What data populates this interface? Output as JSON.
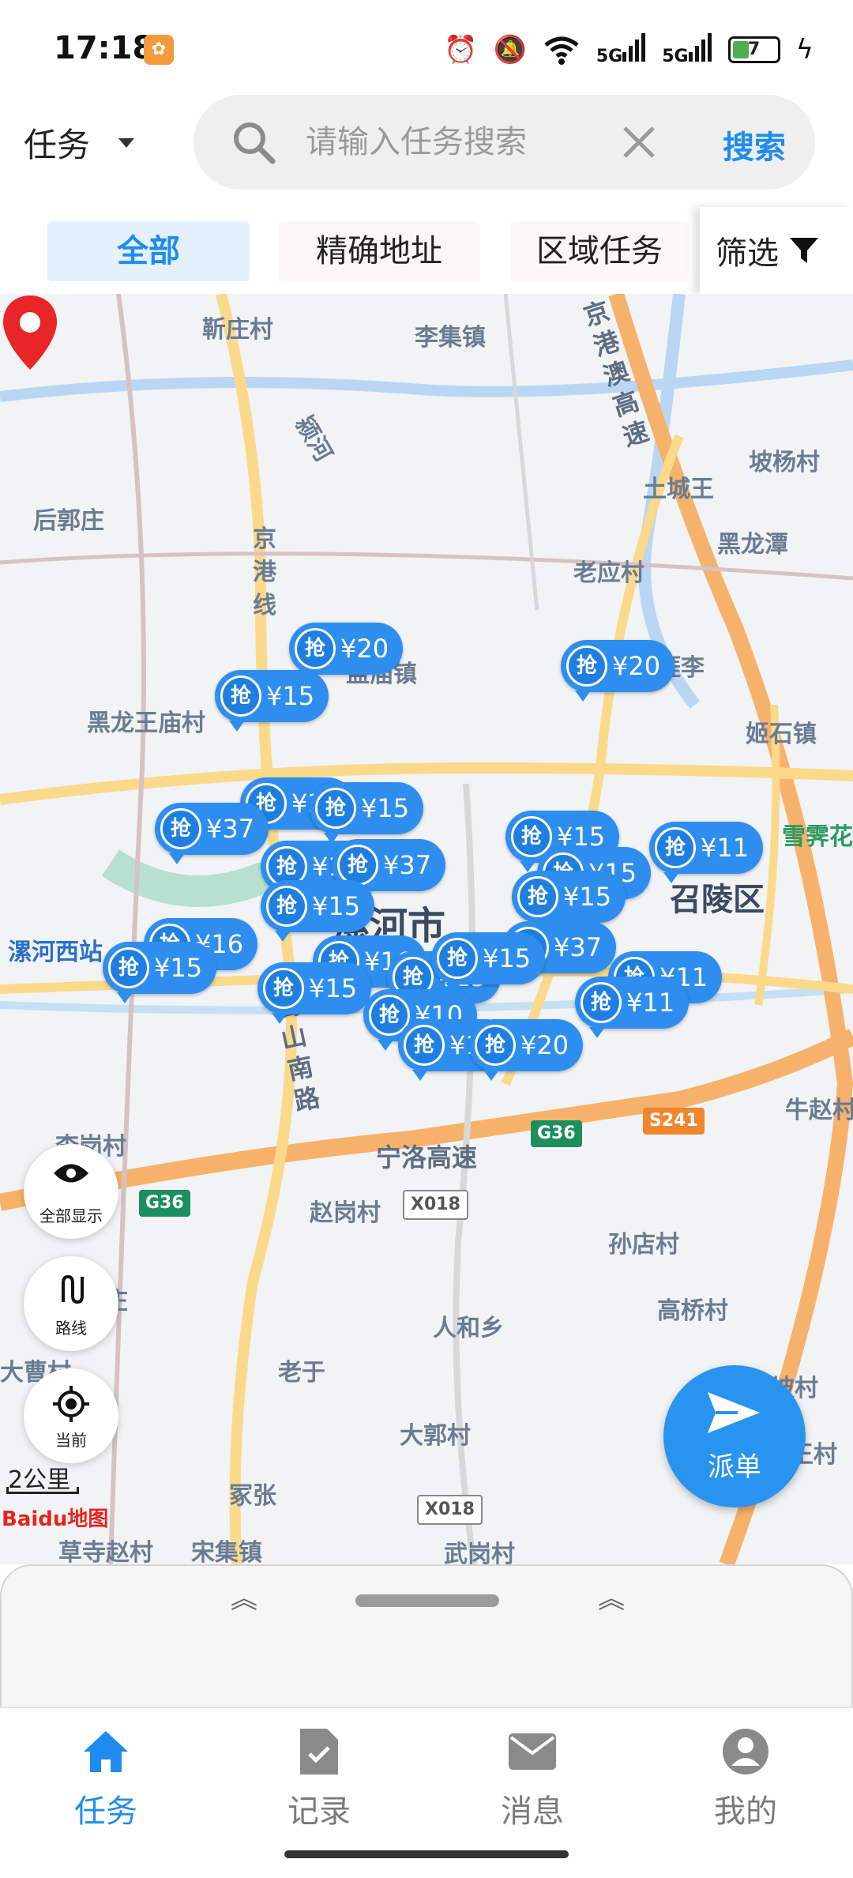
{
  "status_bar": {
    "time": "17:18",
    "signal_1": "5G",
    "signal_2": "5G",
    "battery": "7"
  },
  "header": {
    "dropdown_label": "任务",
    "search_placeholder": "请输入任务搜索",
    "search_button": "搜索"
  },
  "tabs": [
    {
      "label": "全部",
      "active": true
    },
    {
      "label": "精确地址",
      "active": false
    },
    {
      "label": "区域任务",
      "active": false
    }
  ],
  "filter_label": "筛选",
  "map": {
    "places": {
      "xinzhuang": "靳庄村",
      "lijizhen": "李集镇",
      "yinghe": "颍河",
      "poyang": "坡杨村",
      "tuchengwang": "土城王",
      "houguozhuang": "后郭庄",
      "heilongtan": "黑龙潭",
      "jinggangxian": "京港线",
      "laoying": "老应村",
      "mengmiao": "孟庙镇",
      "yali": "涯李",
      "heilongwangmiao": "黑龙王庙村",
      "jishi": "姬石镇",
      "xuezhai": "雪霁花",
      "zhaoling": "召陵区",
      "luohe": "漯河市",
      "luohexi": "漯河西站",
      "niuzhao": "牛赵村",
      "ligang": "李岗村",
      "songshan": "嵩山南路",
      "ningluo": "宁洛高速",
      "zhaogang": "赵岗村",
      "sundian": "孙店村",
      "gaoqiao": "高桥村",
      "renhe": "人和乡",
      "laoyu": "老于",
      "dacao": "大曹村",
      "xiapo": "下坡村",
      "daguo": "大郭村",
      "jiazhang": "冢张",
      "wanghe": "王村",
      "caosizhao": "草寺赵村",
      "songji": "宋集镇",
      "wugang": "武岗村",
      "zhuang": "庄",
      "jinggangao": "京港澳高速"
    },
    "shields": {
      "g36a": "G36",
      "g36b": "G36",
      "s241": "S241",
      "x018a": "X018",
      "x018b": "X018"
    },
    "pin_badge": "抢",
    "pins": [
      "¥20",
      "¥15",
      "¥20",
      "¥37",
      "¥15",
      "¥37",
      "¥15",
      "¥37",
      "¥15",
      "¥15",
      "¥15",
      "¥15",
      "¥11",
      "¥16",
      "¥15",
      "¥16",
      "¥15",
      "¥15",
      "¥37",
      "¥15",
      "¥11",
      "¥11",
      "¥10",
      "¥10",
      "¥20"
    ],
    "controls": {
      "show_all": "全部显示",
      "route": "路线",
      "current": "当前"
    },
    "scale": "2公里",
    "logo": "Baidu地图",
    "dispatch": "派单"
  },
  "nav": [
    {
      "label": "任务",
      "active": true
    },
    {
      "label": "记录",
      "active": false
    },
    {
      "label": "消息",
      "active": false
    },
    {
      "label": "我的",
      "active": false
    }
  ],
  "colors": {
    "accent": "#1f8cf0",
    "pin": "#2e8ef0",
    "marker": "#e8262a"
  }
}
